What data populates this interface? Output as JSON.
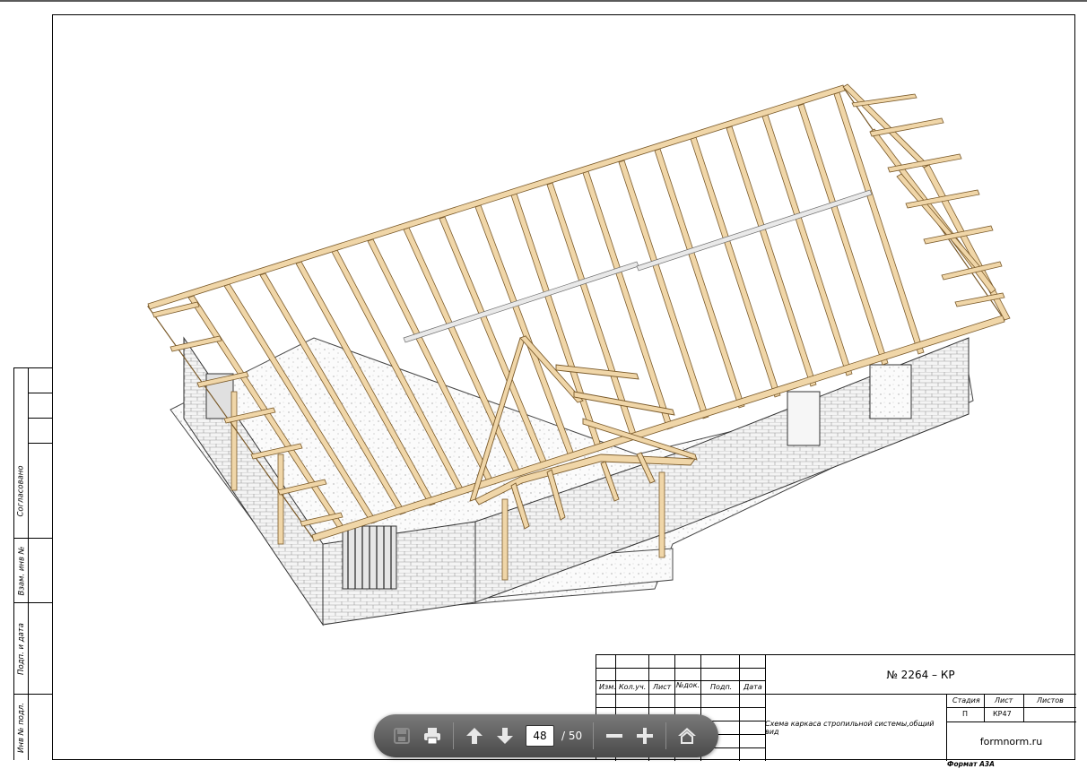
{
  "viewer": {
    "toolbar": {
      "current_page": "48",
      "total_pages": "/ 50",
      "buttons": {
        "save": "save-icon",
        "print": "print-icon",
        "prev": "arrow-up-icon",
        "next": "arrow-down-icon",
        "zoom_out": "minus-icon",
        "zoom_in": "plus-icon",
        "home": "home-icon"
      }
    }
  },
  "side_stamp": {
    "approved": "Согласовано",
    "vzam_inv": "Взам. инв №",
    "sign_date": "Подп. и дата",
    "inv_orig": "Инв № подл."
  },
  "title_block": {
    "columns": [
      "Изм.",
      "Кол.уч.",
      "Лист",
      "№док.",
      "Подп.",
      "Дата"
    ],
    "document_number": "№ 2264 – КР",
    "description": "Схема каркаса стропильной системы,общий вид",
    "stage_header": "Стадия",
    "sheet_header": "Лист",
    "sheets_header": "Листов",
    "stage_value": "П",
    "sheet_value": "КР47",
    "sheets_value": "",
    "website": "formnorm.ru"
  },
  "format_label": "Формат А3А",
  "colors": {
    "timber": "#f0d6a8",
    "timber_edge": "#7a5a2a",
    "masonry": "#f2f2f2"
  }
}
